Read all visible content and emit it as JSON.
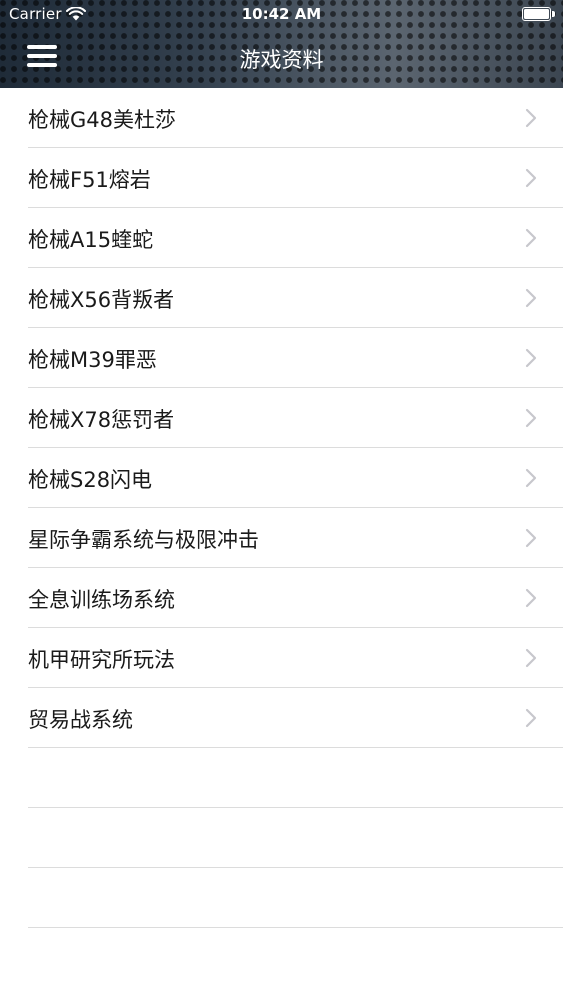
{
  "status_bar": {
    "carrier": "Carrier",
    "time": "10:42 AM",
    "wifi_icon": "wifi-icon",
    "battery_icon": "battery-icon"
  },
  "nav_bar": {
    "title": "游戏资料",
    "menu_icon": "hamburger-menu-icon"
  },
  "list": {
    "items": [
      {
        "label": "枪械G48美杜莎"
      },
      {
        "label": "枪械F51熔岩"
      },
      {
        "label": "枪械A15蝰蛇"
      },
      {
        "label": "枪械X56背叛者"
      },
      {
        "label": "枪械M39罪恶"
      },
      {
        "label": "枪械X78惩罚者"
      },
      {
        "label": "枪械S28闪电"
      },
      {
        "label": "星际争霸系统与极限冲击"
      },
      {
        "label": "全息训练场系统"
      },
      {
        "label": "机甲研究所玩法"
      },
      {
        "label": "贸易战系统"
      }
    ],
    "chevron_icon": "chevron-right-icon"
  },
  "colors": {
    "header_bg": "#2a3440",
    "text": "#1a1a1a",
    "separator": "#dcdcdc",
    "chevron": "#c7c7cc"
  }
}
